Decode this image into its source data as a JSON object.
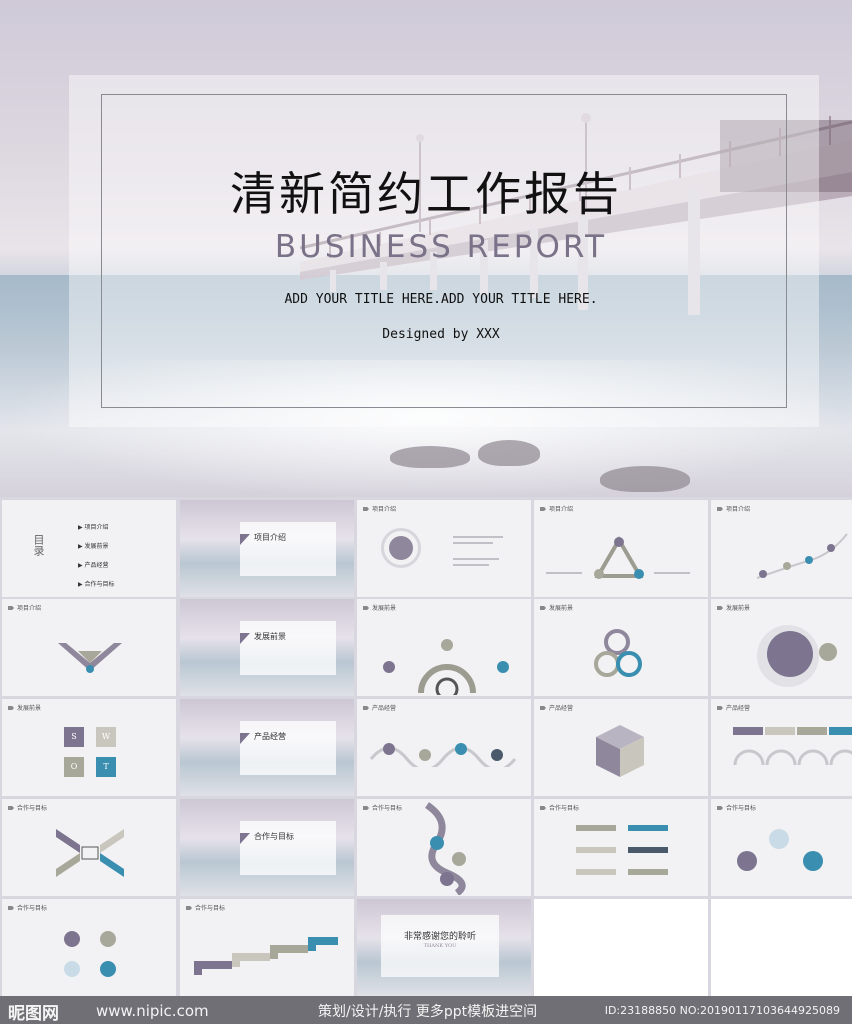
{
  "cover": {
    "title": "清新简约工作报告",
    "subtitle": "BUSINESS REPORT",
    "tagline": "ADD YOUR TITLE HERE.ADD YOUR TITLE HERE.",
    "designed_by": "Designed by XXX"
  },
  "slides": {
    "toc_title": "目录",
    "toc_items": [
      "项目介绍",
      "发展前景",
      "产品经营",
      "合作与目标"
    ],
    "headings": [
      "项目介绍",
      "项目介绍",
      "项目介绍",
      "项目介绍",
      "发展前景",
      "发展前景",
      "发展前景",
      "发展前景",
      "产品经营",
      "产品经营",
      "产品经营",
      "合作与目标",
      "合作与目标",
      "合作与目标",
      "合作与目标"
    ],
    "section_titles": [
      "项目介绍",
      "发展前景",
      "产品经营",
      "合作与目标"
    ],
    "swot": [
      "S",
      "W",
      "O",
      "T"
    ],
    "thanks": "非常感谢您的聆听",
    "thanks_sub": "THANK YOU"
  },
  "footer": {
    "logo": "昵图网",
    "url": "www.nipic.com",
    "promo": "策划/设计/执行    更多ppt模板进空间",
    "id": "ID:23188850 NO:20190117103644925089"
  },
  "colors": {
    "accent_purple": "#7d7590",
    "accent_blue": "#3a8fb0",
    "accent_gray": "#a7a79a"
  }
}
